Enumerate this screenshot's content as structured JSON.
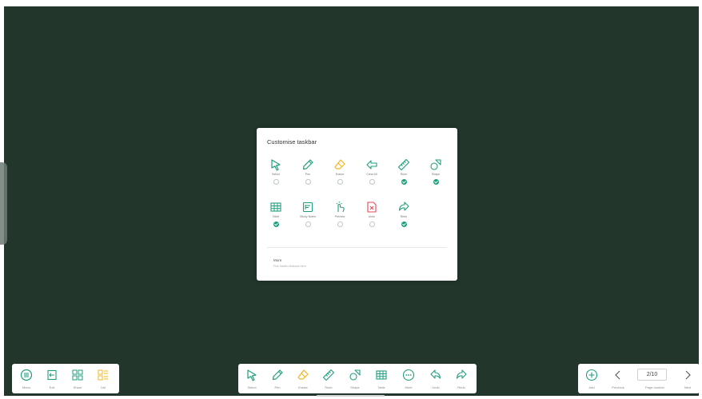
{
  "dialog": {
    "title": "Customise taskbar",
    "options": [
      {
        "label": "Select",
        "icon": "select-icon",
        "checked": false
      },
      {
        "label": "Pen",
        "icon": "pen-icon",
        "checked": false
      },
      {
        "label": "Eraser",
        "icon": "eraser-icon",
        "checked": false
      },
      {
        "label": "Clear All",
        "icon": "clear-all-icon",
        "checked": false
      },
      {
        "label": "Ruler",
        "icon": "ruler-icon",
        "checked": true
      },
      {
        "label": "Shape",
        "icon": "shape-icon",
        "checked": true
      },
      {
        "label": "Table",
        "icon": "table-icon",
        "checked": true
      },
      {
        "label": "Sticky Notes",
        "icon": "sticky-notes-icon",
        "checked": false
      },
      {
        "label": "Preview",
        "icon": "preview-icon",
        "checked": false
      },
      {
        "label": "Undo",
        "icon": "undo-icon",
        "checked": false
      },
      {
        "label": "Redo",
        "icon": "redo-icon",
        "checked": true
      }
    ],
    "more_label": "More",
    "more_hint": "Five hidden features here"
  },
  "left_bar": {
    "items": [
      {
        "label": "Menu",
        "icon": "menu-icon"
      },
      {
        "label": "Exit",
        "icon": "exit-icon"
      },
      {
        "label": "Share",
        "icon": "share-icon"
      },
      {
        "label": "List",
        "icon": "list-icon"
      }
    ]
  },
  "center_bar": {
    "items": [
      {
        "label": "Select",
        "icon": "select-icon"
      },
      {
        "label": "Pen",
        "icon": "pen-icon"
      },
      {
        "label": "Eraser",
        "icon": "eraser-icon"
      },
      {
        "label": "Ruler",
        "icon": "ruler-icon"
      },
      {
        "label": "Shape",
        "icon": "shape-icon"
      },
      {
        "label": "Table",
        "icon": "table-icon"
      },
      {
        "label": "More",
        "icon": "more-icon"
      },
      {
        "label": "Undo",
        "icon": "undo-icon"
      },
      {
        "label": "Redo",
        "icon": "redo-icon"
      }
    ]
  },
  "right_bar": {
    "add_label": "Add",
    "previous_label": "Previous",
    "page_number_label": "Page number",
    "next_label": "Next",
    "page_value": "2/10"
  },
  "colors": {
    "board": "#22362b",
    "accent": "#1f9e7e",
    "eraser_accent": "#f2b623",
    "preview_accent": "#e8455a"
  }
}
